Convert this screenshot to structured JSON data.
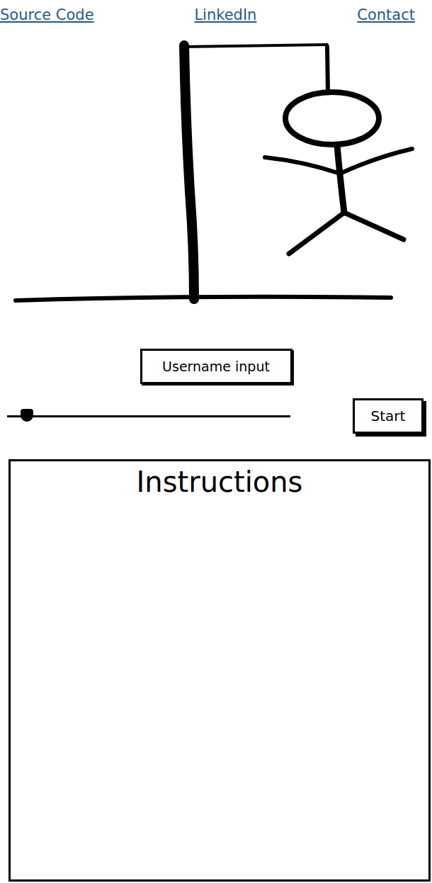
{
  "nav": {
    "links": [
      {
        "label": "Source Code"
      },
      {
        "label": "LinkedIn"
      },
      {
        "label": "Contact"
      }
    ]
  },
  "username": {
    "placeholder": "Username input"
  },
  "difficulty_slider": {
    "level": 0.07
  },
  "buttons": {
    "start": "Start"
  },
  "instructions": {
    "title": "Instructions"
  }
}
